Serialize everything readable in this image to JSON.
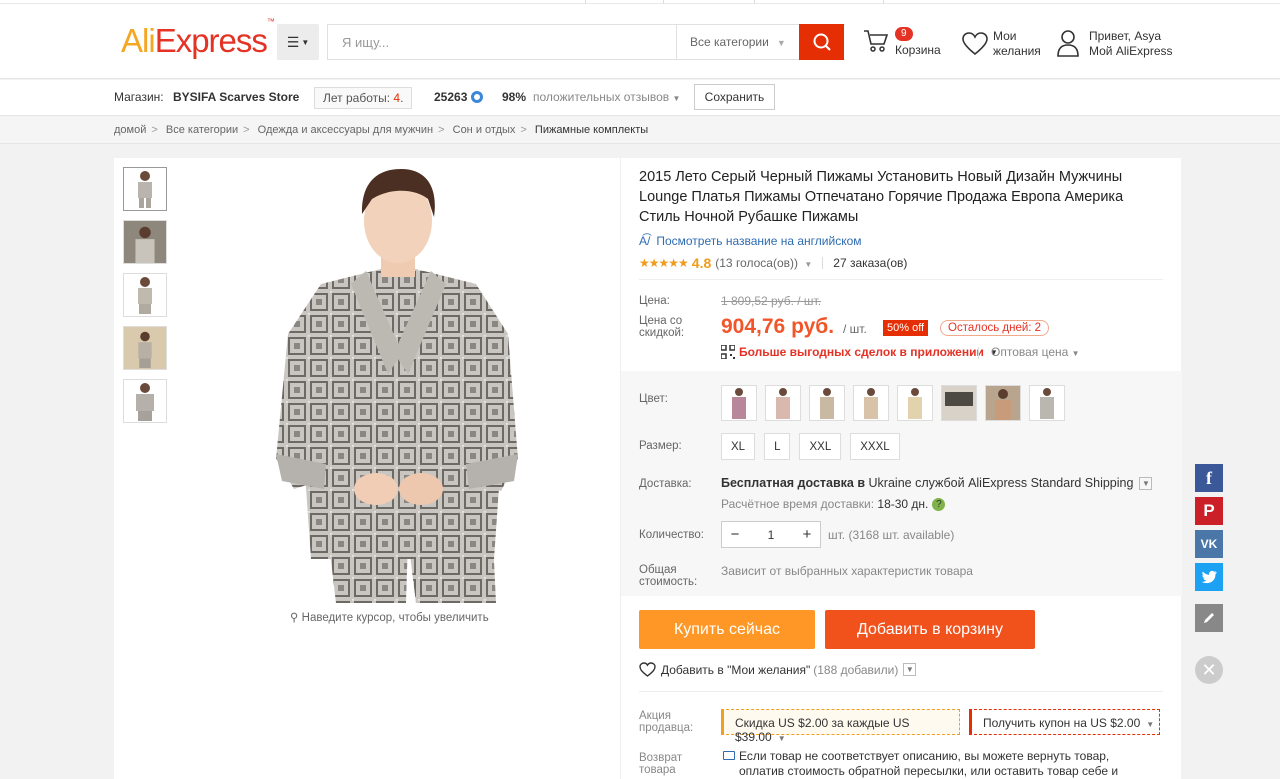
{
  "header": {
    "logo_main": "AliExpress",
    "search_placeholder": "Я ищу...",
    "search_category": "Все категории",
    "cart_count": "9",
    "cart_label": "Корзина",
    "wishlist_line1": "Мои",
    "wishlist_line2": "желания",
    "user_line1": "Привет, Asya",
    "user_line2": "Мой AliExpress"
  },
  "store": {
    "label": "Магазин:",
    "name": "BYSIFA Scarves Store",
    "years_label": "Лет работы:",
    "years_value": "4",
    "score": "25263",
    "positive_pct": "98%",
    "positive_label": "положительных отзывов",
    "save_label": "Сохранить"
  },
  "breadcrumb": [
    "домой",
    "Все категории",
    "Одежда и аксессуары для мужчин",
    "Сон и отдых",
    "Пижамные комплекты"
  ],
  "gallery": {
    "zoom_hint": "Наведите курсор, чтобы увеличить",
    "thumb_count": 5
  },
  "product": {
    "title": "2015 Лето Серый Черный Пижамы Установить Новый Дизайн Мужчины Lounge Платья Пижамы Отпечатано Горячие Продажа Европа Америка Стиль Ночной Рубашке Пижамы",
    "translate_link": "Посмотреть название на английском",
    "rating_stars": "★★★★★",
    "rating_value": "4.8",
    "votes": "(13 голоса(ов))",
    "orders": "27 заказа(ов)",
    "price_label": "Цена:",
    "old_price": "1 809,52 руб. / шт.",
    "discount_label": "Цена со скидкой:",
    "new_price": "904,76 руб.",
    "unit": "/ шт.",
    "discount_badge": "50% off",
    "days_left": "Осталось дней: 2",
    "app_deals": "Больше выгодных сделок в приложении",
    "wholesale": "Оптовая цена"
  },
  "sku": {
    "color_label": "Цвет:",
    "swatch_count": 8,
    "size_label": "Размер:",
    "sizes": [
      "XL",
      "L",
      "XXL",
      "XXXL"
    ],
    "shipping_label": "Доставка:",
    "shipping_free": "Бесплатная доставка в",
    "shipping_rest": " Ukraine службой AliExpress Standard Shipping",
    "delivery_time_label": "Расчётное время доставки:",
    "delivery_time": "18-30 дн.",
    "quantity_label": "Количество:",
    "quantity_value": "1",
    "quantity_note": "шт. (3168 шт. available)",
    "total_label": "Общая стоимость:",
    "total_note": "Зависит от выбранных характеристик товара"
  },
  "actions": {
    "buy_now": "Купить сейчас",
    "add_to_cart": "Добавить в корзину",
    "wishlist": "Добавить в \"Мои желания\"",
    "wishlist_count": "(188 добавили)"
  },
  "promo": {
    "label": "Акция продавца:",
    "discount": "Скидка US $2.00 за каждые US $39.00",
    "coupon": "Получить купон на US $2.00"
  },
  "returns": {
    "label": "Возврат товара",
    "text": "Если товар не соответствует описанию, вы можете вернуть товар, оплатив стоимость обратной пересылки, или оставить товар себе и"
  },
  "colors": {
    "brand_orange": "#f5a623",
    "brand_red": "#e43225",
    "search_button": "#e62e04",
    "buy_now": "#fe9725",
    "add_to_cart": "#f1511b",
    "price": "#f0562a"
  },
  "social": [
    "facebook-icon",
    "pinterest-icon",
    "vk-icon",
    "twitter-icon",
    "edit-icon"
  ]
}
